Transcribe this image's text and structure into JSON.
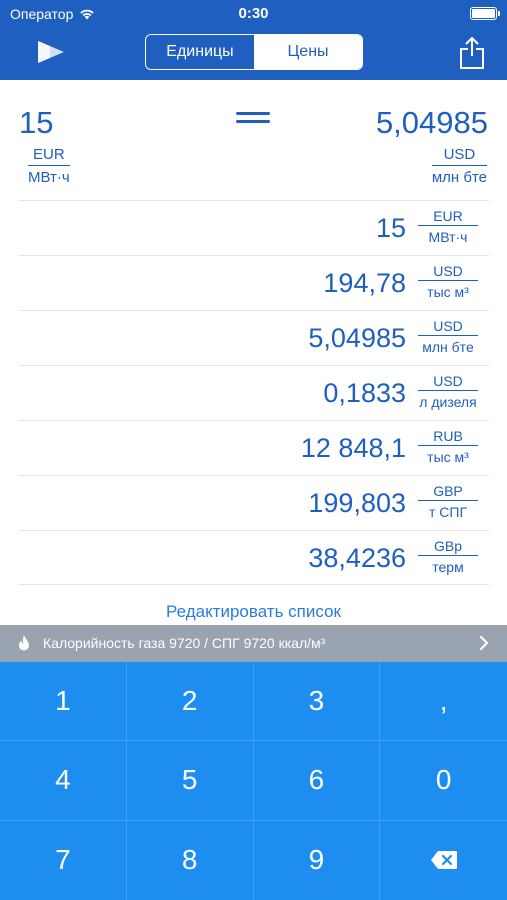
{
  "status_bar": {
    "carrier": "Оператор",
    "time": "0:30"
  },
  "nav": {
    "tabs": [
      {
        "label": "Единицы",
        "active": true
      },
      {
        "label": "Цены",
        "active": false
      }
    ]
  },
  "converter": {
    "input_value": "15",
    "input_unit": {
      "currency": "EUR",
      "unit": "МВт·ч"
    },
    "output_value": "5,04985",
    "output_unit": {
      "currency": "USD",
      "unit": "млн бте"
    }
  },
  "results": [
    {
      "value": "15",
      "currency": "EUR",
      "unit": "МВт·ч"
    },
    {
      "value": "194,78",
      "currency": "USD",
      "unit": "тыс м³"
    },
    {
      "value": "5,04985",
      "currency": "USD",
      "unit": "млн бте"
    },
    {
      "value": "0,1833",
      "currency": "USD",
      "unit": "л дизеля"
    },
    {
      "value": "12 848,1",
      "currency": "RUB",
      "unit": "тыс м³"
    },
    {
      "value": "199,803",
      "currency": "GBP",
      "unit": "т СПГ"
    },
    {
      "value": "38,4236",
      "currency": "GBp",
      "unit": "терм"
    }
  ],
  "edit_list_label": "Редактировать список",
  "info_bar": {
    "text": "Калорийность газа 9720 / СПГ 9720 ккал/м³"
  },
  "keypad": {
    "keys": [
      "1",
      "2",
      "3",
      ",",
      "4",
      "5",
      "6",
      "0",
      "7",
      "8",
      "9"
    ]
  },
  "colors": {
    "primary": "#1f5fbf",
    "keypad": "#1e8df0",
    "info_bar": "#9aa3b0",
    "link": "#2a7be0"
  }
}
